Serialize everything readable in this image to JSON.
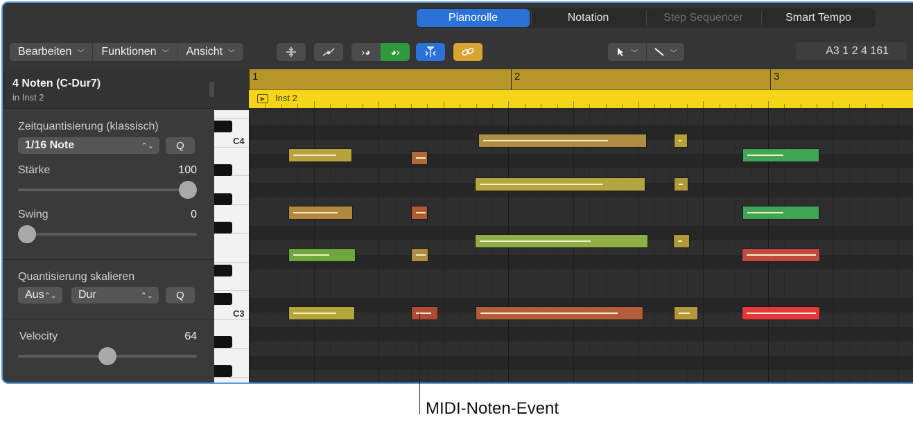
{
  "tabs": [
    {
      "label": "Pianorolle",
      "active": true
    },
    {
      "label": "Notation",
      "active": false
    },
    {
      "label": "Step Sequencer",
      "active": false,
      "disabled": true
    },
    {
      "label": "Smart Tempo",
      "active": false
    }
  ],
  "menus": {
    "edit": "Bearbeiten",
    "functions": "Funktionen",
    "view": "Ansicht"
  },
  "position": "A3   1 2 4 161",
  "inspector": {
    "title": "4 Noten (C-Dur7)",
    "subtitle": "in Inst 2",
    "time_quantize_label": "Zeitquantisierung (klassisch)",
    "time_quantize_value": "1/16 Note",
    "q_label": "Q",
    "strength_label": "Stärke",
    "strength_value": "100",
    "strength_level": 1.0,
    "swing_label": "Swing",
    "swing_value": "0",
    "swing_level": 0.0,
    "scale_quantize_label": "Quantisierung skalieren",
    "scale_off": "Aus",
    "scale_mode": "Dur",
    "velocity_label": "Velocity",
    "velocity_value": "64",
    "velocity_level": 0.5
  },
  "keyboard": {
    "label_c4": "C4",
    "label_c3": "C3"
  },
  "ruler": {
    "bar1": "1",
    "bar2": "2",
    "bar3": "3"
  },
  "region": {
    "name": "Inst 2"
  },
  "colors": {
    "accent": "#2a71d8",
    "region": "#f5d51a",
    "ruler": "#b69629"
  },
  "callout": "MIDI-Noten-Event"
}
